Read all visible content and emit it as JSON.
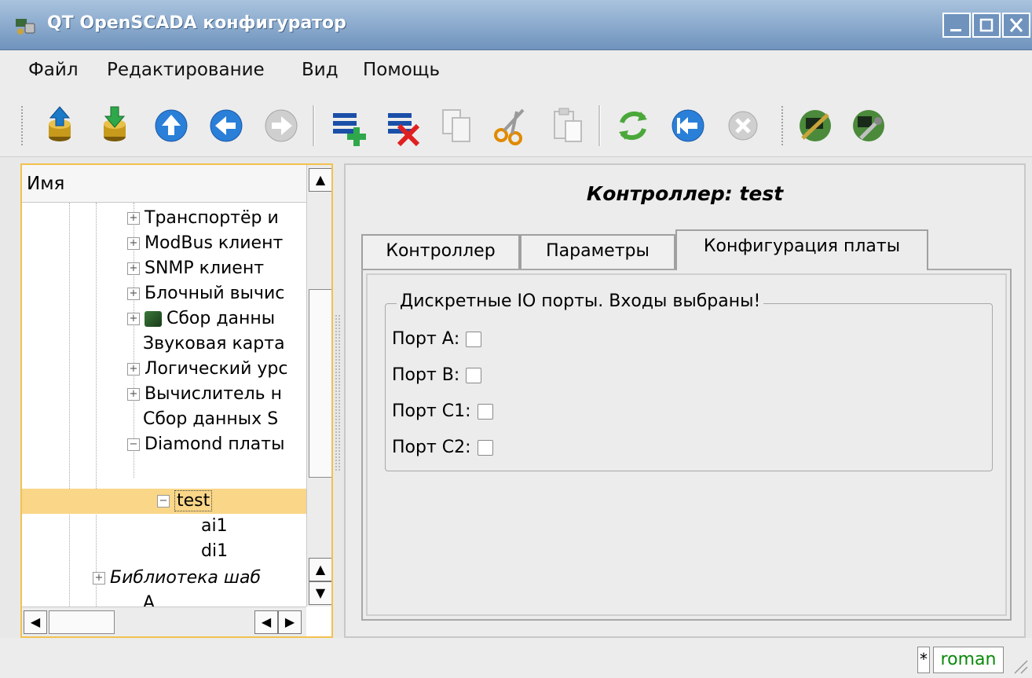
{
  "window": {
    "title": "QT OpenSCADA конфигуратор"
  },
  "menu": {
    "file_label": "Файл",
    "edit_label": "Редактирование",
    "view_label": "Вид",
    "help_label": "Помощь"
  },
  "toolbar": {
    "buttons": [
      "db-load",
      "db-save",
      "up",
      "back",
      "forward",
      "item-add",
      "item-delete",
      "copy",
      "cut",
      "paste",
      "refresh",
      "start",
      "stop",
      "module-1",
      "module-2"
    ]
  },
  "tree": {
    "header": "Имя",
    "items": [
      {
        "label": "Транспортёр и"
      },
      {
        "label": "ModBus клиент"
      },
      {
        "label": "SNMP клиент"
      },
      {
        "label": "Блочный вычис"
      },
      {
        "label": "Сбор данны"
      },
      {
        "label": "Звуковая карта"
      },
      {
        "label": "Логический урс"
      },
      {
        "label": "Вычислитель н"
      },
      {
        "label": "Сбор данных S"
      },
      {
        "label": "Diamond платы"
      },
      {
        "label": "test"
      },
      {
        "label": "ai1"
      },
      {
        "label": "di1"
      },
      {
        "label": "Библиотека шаб"
      },
      {
        "label": "А"
      }
    ]
  },
  "main": {
    "title": "Контроллер: test",
    "tabs": [
      {
        "label": "Контроллер"
      },
      {
        "label": "Параметры"
      },
      {
        "label": "Конфигурация платы"
      }
    ],
    "group_title": "Дискретные IO порты. Входы выбраны!",
    "ports": [
      {
        "label": "Порт А:",
        "checked": false
      },
      {
        "label": "Порт В:",
        "checked": false
      },
      {
        "label": "Порт С1:",
        "checked": false
      },
      {
        "label": "Порт С2:",
        "checked": false
      }
    ]
  },
  "status": {
    "modified": "*",
    "user": "roman"
  },
  "colors": {
    "selection": "#f9d688",
    "tree_focus_border": "#f2c14e",
    "user_text": "#0a8a0a",
    "title_bar": "#6f93bd"
  }
}
